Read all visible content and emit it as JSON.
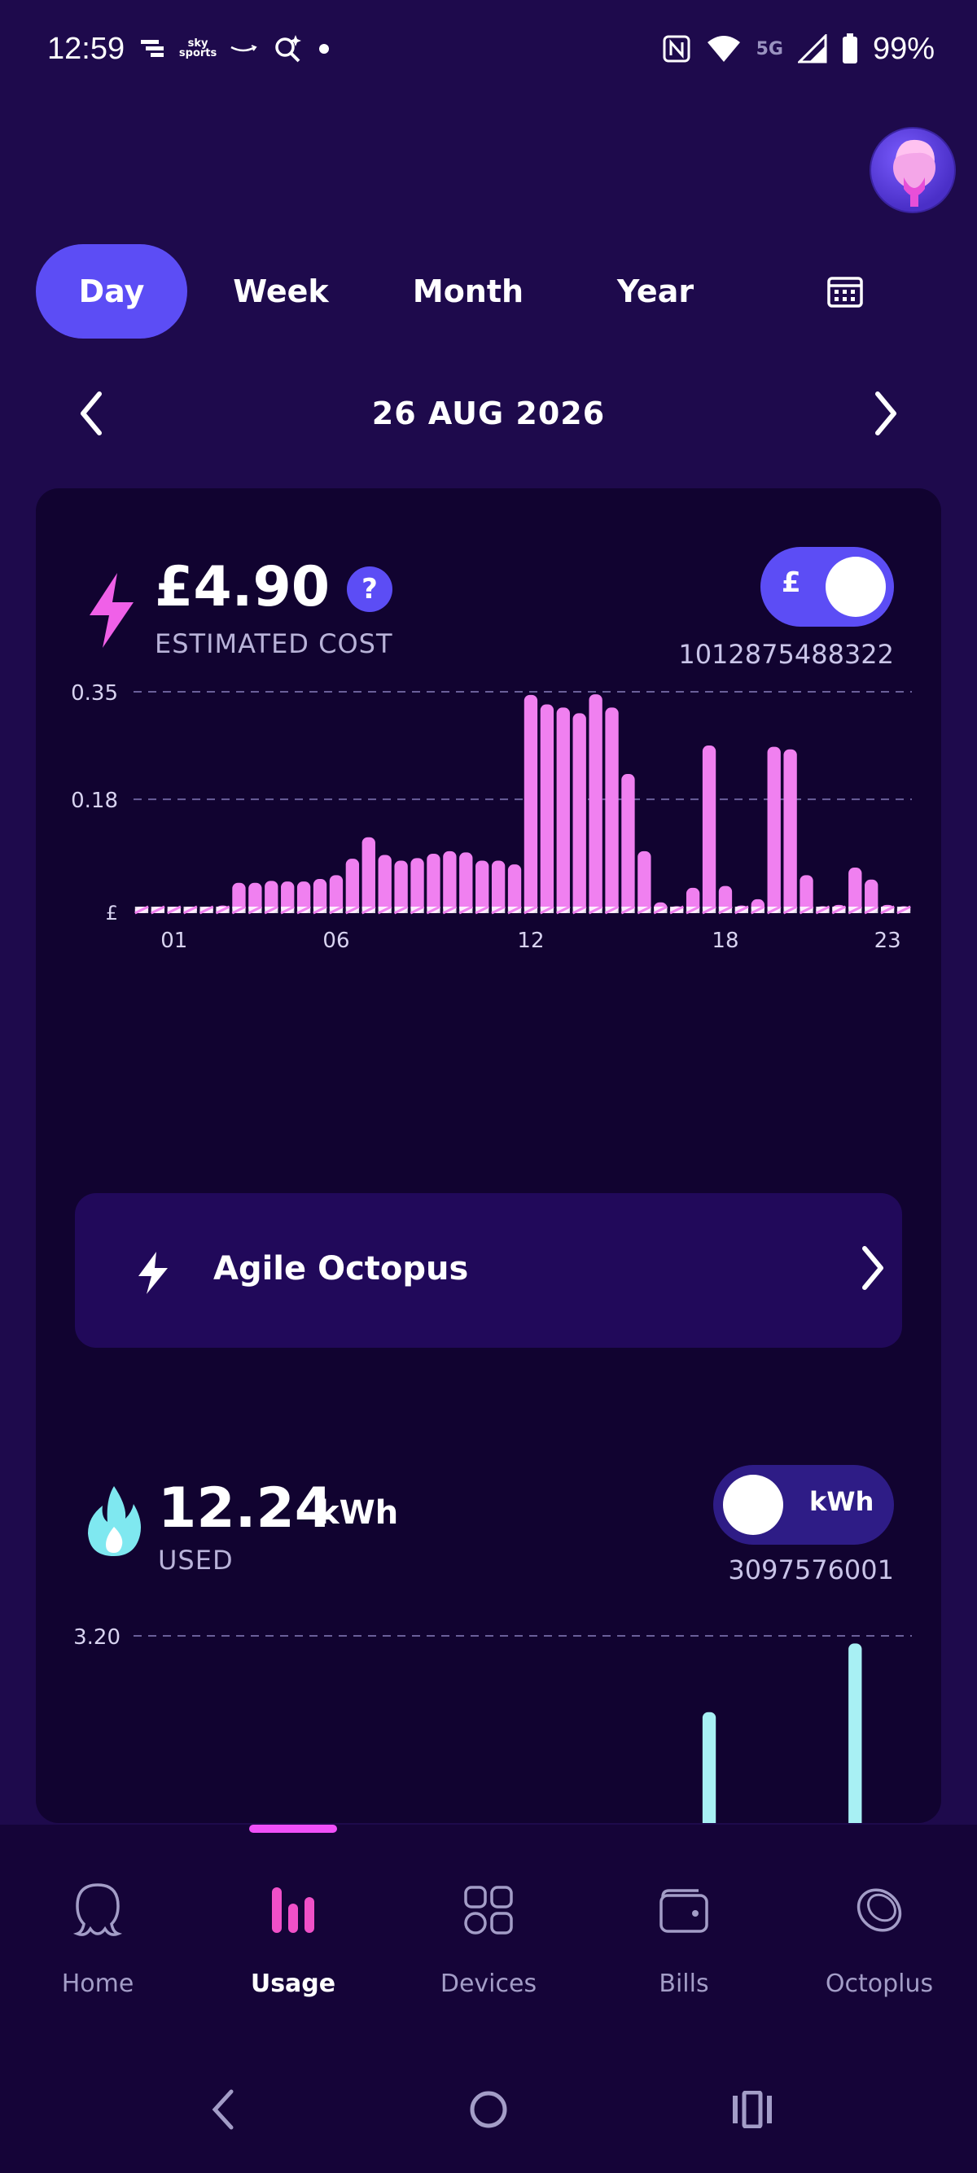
{
  "status_bar": {
    "time": "12:59",
    "sky_label": "sky sports",
    "battery": "99%",
    "network": "5G"
  },
  "tabs": [
    {
      "label": "Day",
      "active": true
    },
    {
      "label": "Week",
      "active": false
    },
    {
      "label": "Month",
      "active": false
    },
    {
      "label": "Year",
      "active": false
    }
  ],
  "date": "26 AUG 2026",
  "electricity": {
    "cost": "£4.90",
    "help": "?",
    "label": "ESTIMATED COST",
    "toggle_symbol": "£",
    "meter_id": "1012875488322",
    "color": "#f080f0"
  },
  "tariff": {
    "name": "Agile Octopus"
  },
  "gas": {
    "value": "12.24",
    "unit": "kWh",
    "label": "USED",
    "toggle_symbol": "kWh",
    "meter_id": "3097576001",
    "color": "#a8f0f4"
  },
  "chart_data": [
    {
      "type": "bar",
      "y_unit_label": "£",
      "y_ticks": [
        "0.35",
        "0.18",
        "£"
      ],
      "x_tick_labels": [
        "01",
        "06",
        "12",
        "18",
        "23"
      ],
      "ylim": [
        0,
        0.35
      ],
      "grid": true,
      "values": [
        0.01,
        0.01,
        0.01,
        0.01,
        0.01,
        0.012,
        0.048,
        0.048,
        0.051,
        0.05,
        0.05,
        0.054,
        0.06,
        0.086,
        0.12,
        0.092,
        0.083,
        0.087,
        0.094,
        0.098,
        0.096,
        0.083,
        0.083,
        0.077,
        0.345,
        0.33,
        0.325,
        0.316,
        0.346,
        0.325,
        0.22,
        0.098,
        0.017,
        0.011,
        0.04,
        0.265,
        0.043,
        0.012,
        0.022,
        0.263,
        0.259,
        0.06,
        0.011,
        0.013,
        0.072,
        0.053,
        0.013,
        0.011
      ]
    },
    {
      "type": "bar",
      "y_ticks": [
        "3.20"
      ],
      "ylim": [
        0,
        3.2
      ],
      "grid": true,
      "visible_values": [
        {
          "slot": 35,
          "value": 2.2
        },
        {
          "slot": 44,
          "value": 3.1
        }
      ]
    }
  ],
  "bottom_nav": [
    {
      "label": "Home",
      "active": false
    },
    {
      "label": "Usage",
      "active": true
    },
    {
      "label": "Devices",
      "active": false
    },
    {
      "label": "Bills",
      "active": false
    },
    {
      "label": "Octoplus",
      "active": false
    }
  ]
}
